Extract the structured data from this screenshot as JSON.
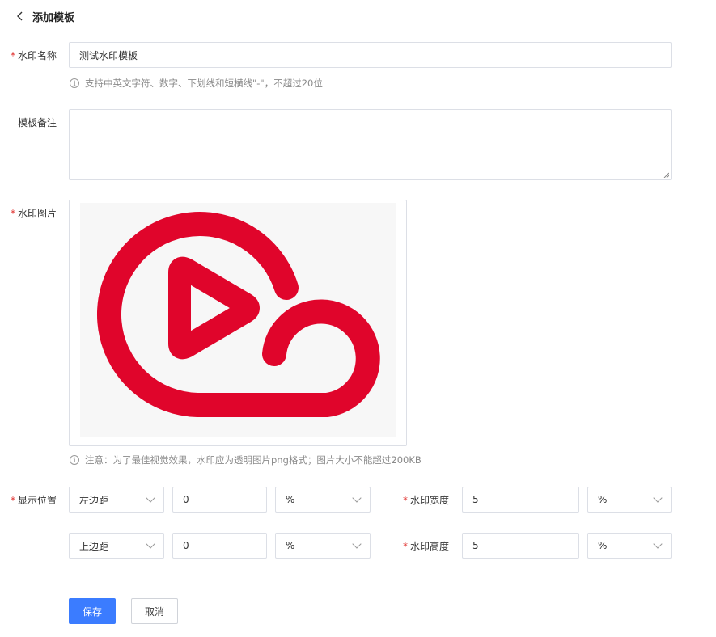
{
  "header": {
    "title": "添加模板",
    "back_icon": "chevron-left-icon"
  },
  "form": {
    "name": {
      "label": "水印名称",
      "value": "测试水印模板",
      "hint": "支持中英文字符、数字、下划线和短横线\"-\"，不超过20位"
    },
    "remark": {
      "label": "模板备注",
      "value": ""
    },
    "image": {
      "label": "水印图片",
      "hint": "注意：为了最佳视觉效果，水印应为透明图片png格式；图片大小不能超过200KB",
      "logo_color": "#e0052b"
    },
    "position": {
      "label": "显示位置",
      "row1": {
        "side": "左边距",
        "value": "0",
        "unit": "%"
      },
      "row2": {
        "side": "上边距",
        "value": "0",
        "unit": "%"
      }
    },
    "width": {
      "label": "水印宽度",
      "value": "5",
      "unit": "%"
    },
    "height": {
      "label": "水印高度",
      "value": "5",
      "unit": "%"
    }
  },
  "actions": {
    "save": "保存",
    "cancel": "取消"
  },
  "colors": {
    "primary": "#3b7cff",
    "required": "#e0302e"
  }
}
